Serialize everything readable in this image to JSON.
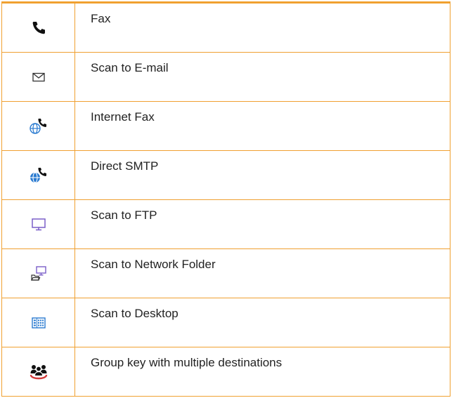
{
  "rows": [
    {
      "label": "Fax",
      "icon": "phone-icon"
    },
    {
      "label": "Scan to E-mail",
      "icon": "envelope-icon"
    },
    {
      "label": "Internet Fax",
      "icon": "internet-fax-icon"
    },
    {
      "label": "Direct SMTP",
      "icon": "direct-smtp-icon"
    },
    {
      "label": "Scan to FTP",
      "icon": "monitor-icon"
    },
    {
      "label": "Scan to Network Folder",
      "icon": "network-folder-icon"
    },
    {
      "label": "Scan to Desktop",
      "icon": "desktop-icon"
    },
    {
      "label": "Group key with multiple destinations",
      "icon": "group-icon"
    }
  ],
  "colors": {
    "border": "#f0a030",
    "icon_dark": "#111111",
    "icon_blue": "#2b7bd0",
    "icon_purple": "#7a5ec8",
    "icon_red": "#d23a3a"
  }
}
